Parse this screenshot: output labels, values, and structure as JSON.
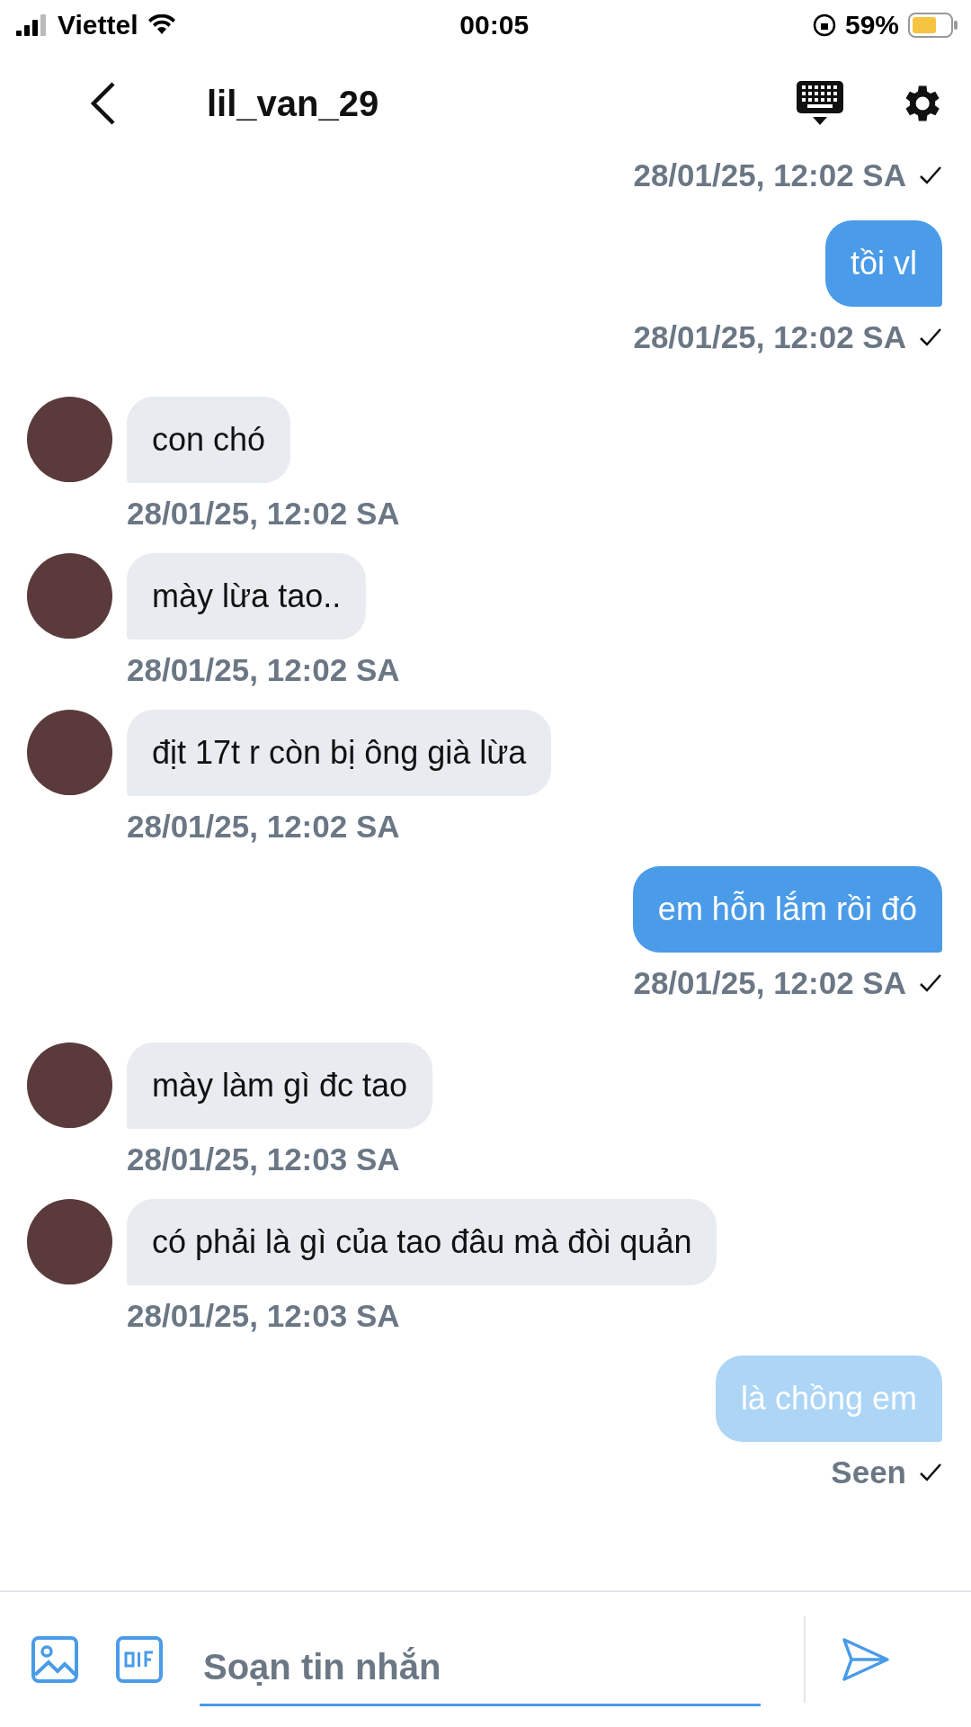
{
  "status_bar": {
    "carrier": "Viettel",
    "time": "00:05",
    "battery": "59%"
  },
  "header": {
    "title": "lil_van_29"
  },
  "top_timestamp": "28/01/25, 12:02 SA",
  "messages": [
    {
      "kind": "sent",
      "text": "tồi vl",
      "time": "28/01/25, 12:02 SA",
      "faded": false
    },
    {
      "kind": "received",
      "text": "con chó",
      "time": "28/01/25, 12:02 SA"
    },
    {
      "kind": "received",
      "text": "mày lừa tao..",
      "time": "28/01/25, 12:02 SA"
    },
    {
      "kind": "received",
      "text": "địt 17t r còn bị ông già lừa",
      "time": "28/01/25, 12:02 SA"
    },
    {
      "kind": "sent",
      "text": "em hỗn lắm rồi đó",
      "time": "28/01/25, 12:02 SA",
      "faded": false
    },
    {
      "kind": "received",
      "text": " mày làm gì đc tao",
      "time": "28/01/25, 12:03 SA"
    },
    {
      "kind": "received",
      "text": "có phải là gì của tao đâu mà đòi quản",
      "time": "28/01/25, 12:03 SA"
    },
    {
      "kind": "sent",
      "text": "là chồng em",
      "time": "Seen",
      "faded": true
    }
  ],
  "composer": {
    "placeholder": "Soạn tin nhắn"
  }
}
